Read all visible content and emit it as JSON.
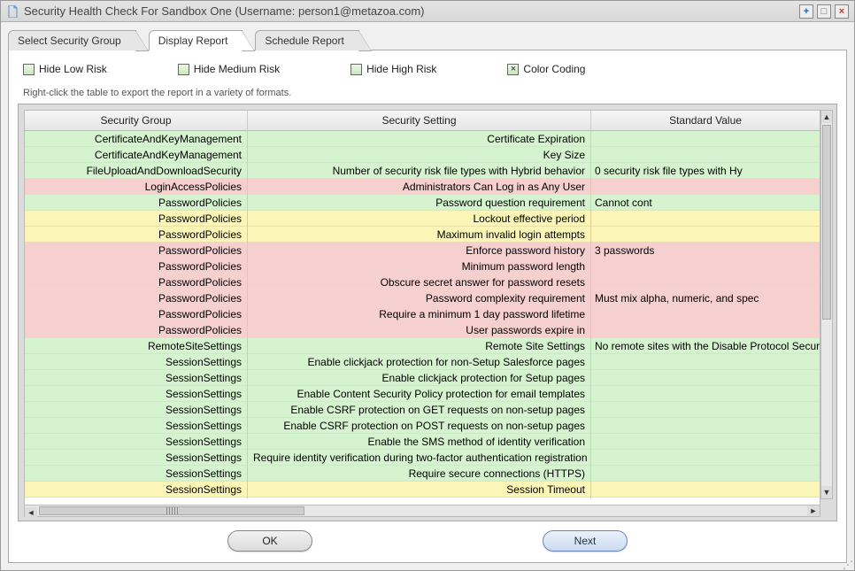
{
  "window": {
    "title": "Security Health Check For Sandbox One (Username: person1@metazoa.com)"
  },
  "tabs": [
    {
      "label": "Select Security Group",
      "active": false
    },
    {
      "label": "Display Report",
      "active": true
    },
    {
      "label": "Schedule Report",
      "active": false
    }
  ],
  "options": {
    "hide_low_risk": {
      "label": "Hide Low Risk",
      "checked": false
    },
    "hide_medium_risk": {
      "label": "Hide Medium Risk",
      "checked": false
    },
    "hide_high_risk": {
      "label": "Hide High Risk",
      "checked": false
    },
    "color_coding": {
      "label": "Color Coding",
      "checked": true
    }
  },
  "hint": "Right-click the table to export the report in a variety of formats.",
  "columns": {
    "group": "Security Group",
    "setting": "Security Setting",
    "value": "Standard Value"
  },
  "rows": [
    {
      "group": "CertificateAndKeyManagement",
      "setting": "Certificate Expiration",
      "value": "",
      "risk": "green"
    },
    {
      "group": "CertificateAndKeyManagement",
      "setting": "Key Size",
      "value": "",
      "risk": "green"
    },
    {
      "group": "FileUploadAndDownloadSecurity",
      "setting": "Number of security risk file types with Hybrid behavior",
      "value": "0 security risk file types with Hy",
      "risk": "green"
    },
    {
      "group": "LoginAccessPolicies",
      "setting": "Administrators Can Log in as Any User",
      "value": "",
      "risk": "pink"
    },
    {
      "group": "PasswordPolicies",
      "setting": "Password question requirement",
      "value": "Cannot cont",
      "risk": "green"
    },
    {
      "group": "PasswordPolicies",
      "setting": "Lockout effective period",
      "value": "",
      "risk": "yellow"
    },
    {
      "group": "PasswordPolicies",
      "setting": "Maximum invalid login attempts",
      "value": "",
      "risk": "yellow"
    },
    {
      "group": "PasswordPolicies",
      "setting": "Enforce password history",
      "value": "3 passwords",
      "risk": "pink"
    },
    {
      "group": "PasswordPolicies",
      "setting": "Minimum password length",
      "value": "",
      "risk": "pink"
    },
    {
      "group": "PasswordPolicies",
      "setting": "Obscure secret answer for password resets",
      "value": "",
      "risk": "pink"
    },
    {
      "group": "PasswordPolicies",
      "setting": "Password complexity requirement",
      "value": "Must mix alpha, numeric, and spec",
      "risk": "pink"
    },
    {
      "group": "PasswordPolicies",
      "setting": "Require a minimum 1 day password lifetime",
      "value": "",
      "risk": "pink"
    },
    {
      "group": "PasswordPolicies",
      "setting": "User passwords expire in",
      "value": "",
      "risk": "pink"
    },
    {
      "group": "RemoteSiteSettings",
      "setting": "Remote Site Settings",
      "value": "No remote sites with the Disable Protocol Security op",
      "risk": "green"
    },
    {
      "group": "SessionSettings",
      "setting": "Enable clickjack protection for non-Setup Salesforce pages",
      "value": "",
      "risk": "green"
    },
    {
      "group": "SessionSettings",
      "setting": "Enable clickjack protection for Setup pages",
      "value": "",
      "risk": "green"
    },
    {
      "group": "SessionSettings",
      "setting": "Enable Content Security Policy protection for email templates",
      "value": "",
      "risk": "green"
    },
    {
      "group": "SessionSettings",
      "setting": "Enable CSRF protection on GET requests on non-setup pages",
      "value": "",
      "risk": "green"
    },
    {
      "group": "SessionSettings",
      "setting": "Enable CSRF protection on POST requests on non-setup pages",
      "value": "",
      "risk": "green"
    },
    {
      "group": "SessionSettings",
      "setting": "Enable the SMS method of identity verification",
      "value": "",
      "risk": "green"
    },
    {
      "group": "SessionSettings",
      "setting": "Require identity verification during two-factor authentication registration",
      "value": "",
      "risk": "green"
    },
    {
      "group": "SessionSettings",
      "setting": "Require secure connections (HTTPS)",
      "value": "",
      "risk": "green"
    },
    {
      "group": "SessionSettings",
      "setting": "Session Timeout",
      "value": "",
      "risk": "yellow"
    }
  ],
  "buttons": {
    "ok": "OK",
    "next": "Next"
  }
}
